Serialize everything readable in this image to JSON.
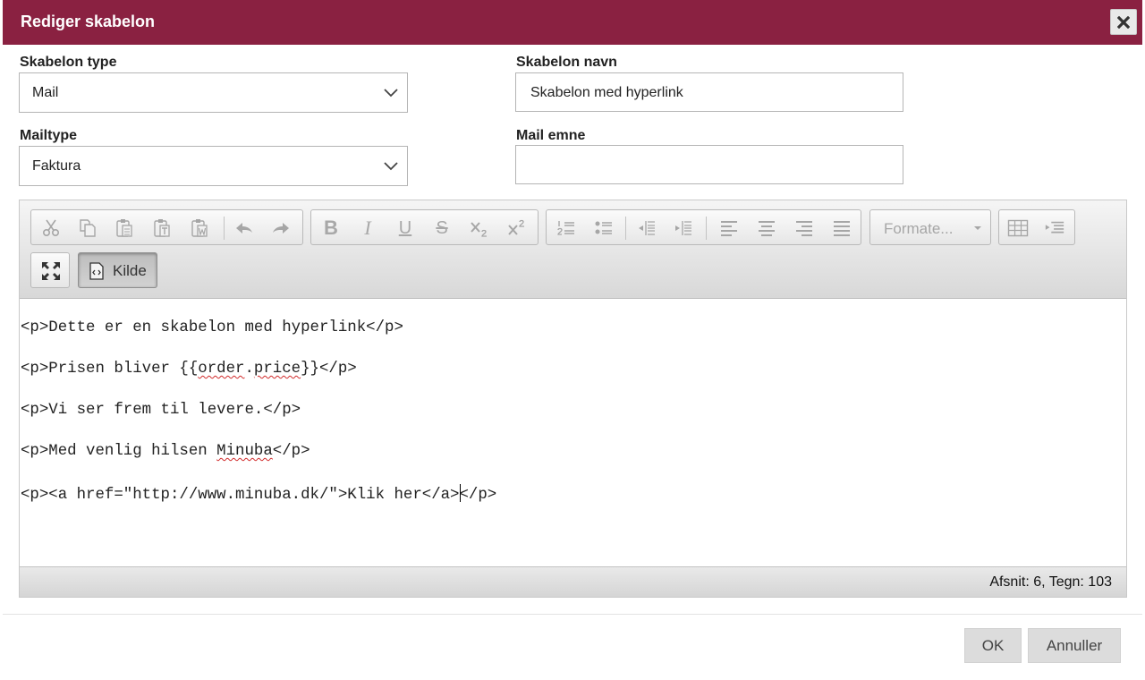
{
  "dialog": {
    "title": "Rediger skabelon",
    "close_icon": "close-icon",
    "accent_color": "#8a2141"
  },
  "form": {
    "template_type_label": "Skabelon type",
    "template_type_value": "Mail",
    "template_name_label": "Skabelon navn",
    "template_name_value": "Skabelon med hyperlink",
    "mail_type_label": "Mailtype",
    "mail_type_value": "Faktura",
    "mail_subject_label": "Mail emne",
    "mail_subject_value": ""
  },
  "editor": {
    "toolbar": {
      "clipboard": [
        "cut-icon",
        "copy-icon",
        "paste-icon",
        "paste-text-icon",
        "paste-word-icon"
      ],
      "history": [
        "undo-icon",
        "redo-icon"
      ],
      "basic_styles": [
        "bold-icon",
        "italic-icon",
        "underline-icon",
        "strike-icon",
        "subscript-icon",
        "superscript-icon"
      ],
      "paragraph": [
        "numbered-list-icon",
        "bulleted-list-icon",
        "outdent-icon",
        "indent-icon",
        "align-left-icon",
        "align-center-icon",
        "align-right-icon",
        "justify-icon"
      ],
      "format_label": "Formate...",
      "insert": [
        "table-icon",
        "blockquote-icon"
      ],
      "maximize_icon": "maximize-icon",
      "source_icon": "source-icon",
      "source_label": "Kilde"
    },
    "source_lines": [
      "<p>Dette er en skabelon med hyperlink</p>",
      "<p>Prisen bliver {{order.price}}</p>",
      "<p>Vi ser frem til levere.</p>",
      "<p>Med venlig hilsen Minuba</p>",
      "<p><a href=\"http://www.minuba.dk/\">Klik her</a></p>"
    ],
    "status": "Afsnit: 6, Tegn: 103"
  },
  "footer": {
    "ok_label": "OK",
    "cancel_label": "Annuller"
  }
}
